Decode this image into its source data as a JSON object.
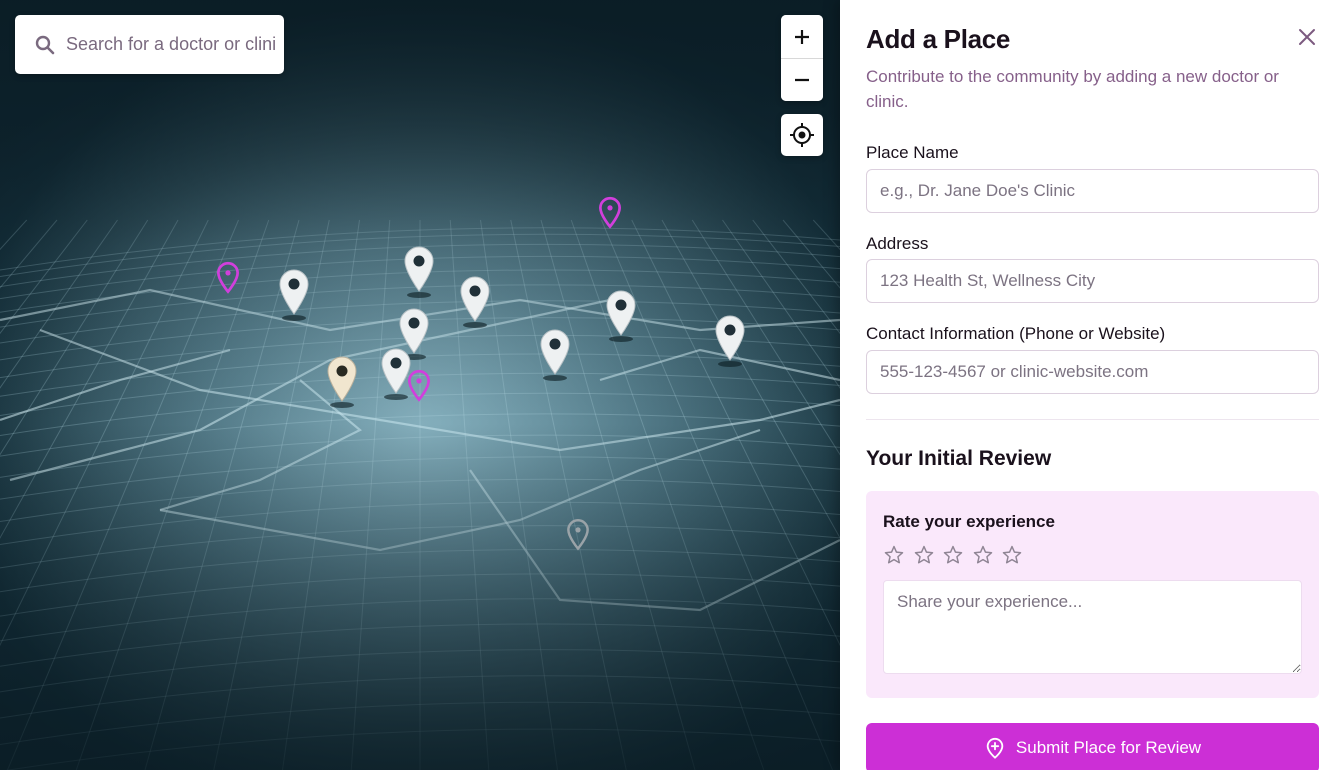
{
  "map": {
    "search_placeholder": "Search for a doctor or clinic...",
    "controls": {
      "zoom_in_icon": "plus-icon",
      "zoom_out_icon": "minus-icon",
      "locate_icon": "crosshair-icon"
    },
    "pin_colors": {
      "highlight": "#d13fdc",
      "marker": "#eef1f2",
      "outline": "#9aa3a8"
    }
  },
  "panel": {
    "title": "Add a Place",
    "subtitle": "Contribute to the community by adding a new doctor or clinic.",
    "close_icon": "close-icon",
    "fields": {
      "name": {
        "label": "Place Name",
        "placeholder": "e.g., Dr. Jane Doe's Clinic"
      },
      "address": {
        "label": "Address",
        "placeholder": "123 Health St, Wellness City"
      },
      "contact": {
        "label": "Contact Information (Phone or Website)",
        "placeholder": "555-123-4567 or clinic-website.com"
      }
    },
    "review": {
      "section_title": "Your Initial Review",
      "rate_label": "Rate your experience",
      "rating": 0,
      "max_rating": 5,
      "textarea_placeholder": "Share your experience..."
    },
    "submit_label": "Submit Place for Review",
    "submit_icon": "location-add-icon"
  },
  "colors": {
    "accent": "#cc2fd6",
    "subtitle": "#86608a",
    "review_bg": "#fae8fb"
  }
}
